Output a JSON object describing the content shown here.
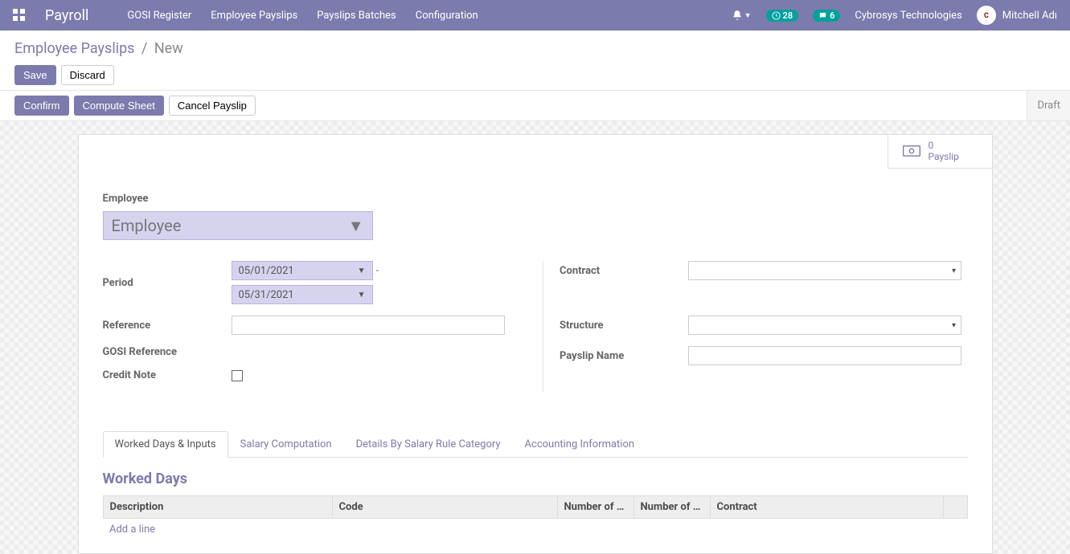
{
  "nav": {
    "brand": "Payroll",
    "items": [
      "GOSI Register",
      "Employee Payslips",
      "Payslips Batches",
      "Configuration"
    ],
    "badge1": "28",
    "badge2": "6",
    "company": "Cybrosys Technologies",
    "user": "Mitchell Adı"
  },
  "breadcrumb": {
    "link": "Employee Payslips",
    "current": "New"
  },
  "buttons": {
    "save": "Save",
    "discard": "Discard",
    "confirm": "Confirm",
    "compute": "Compute Sheet",
    "cancel": "Cancel Payslip",
    "status": "Draft"
  },
  "stat": {
    "count": "0",
    "label": "Payslip"
  },
  "form": {
    "employee_label": "Employee",
    "employee_placeholder": "Employee",
    "period_label": "Period",
    "period_start": "05/01/2021",
    "period_end": "05/31/2021",
    "reference_label": "Reference",
    "gosi_ref_label": "GOSI Reference",
    "credit_note_label": "Credit Note",
    "contract_label": "Contract",
    "structure_label": "Structure",
    "payslip_name_label": "Payslip Name"
  },
  "tabs": {
    "t0": "Worked Days & Inputs",
    "t1": "Salary Computation",
    "t2": "Details By Salary Rule Category",
    "t3": "Accounting Information"
  },
  "worked_days": {
    "title": "Worked Days",
    "cols": [
      "Description",
      "Code",
      "Number of …",
      "Number of …",
      "Contract"
    ],
    "add": "Add a line"
  }
}
